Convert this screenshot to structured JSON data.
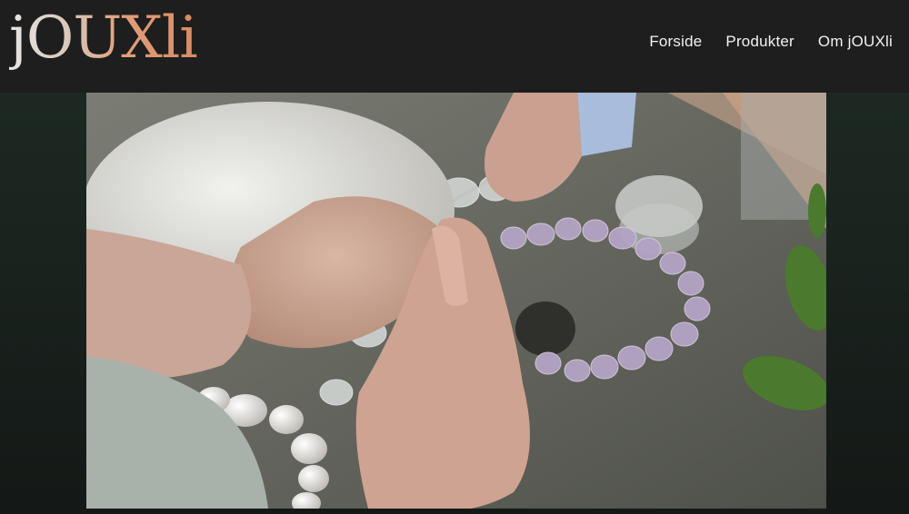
{
  "site": {
    "logo": "jOUXli"
  },
  "nav": {
    "items": [
      {
        "label": "Forside"
      },
      {
        "label": "Produkter"
      },
      {
        "label": "Om jOUXli"
      }
    ]
  },
  "hero": {
    "image_subject": "hands-threading-crystal-necklace"
  },
  "colors": {
    "header_bg": "#1e1e1e",
    "page_bg": "#1b2520",
    "nav_text": "#f2f2f2",
    "logo_accent": "#d88a66"
  }
}
